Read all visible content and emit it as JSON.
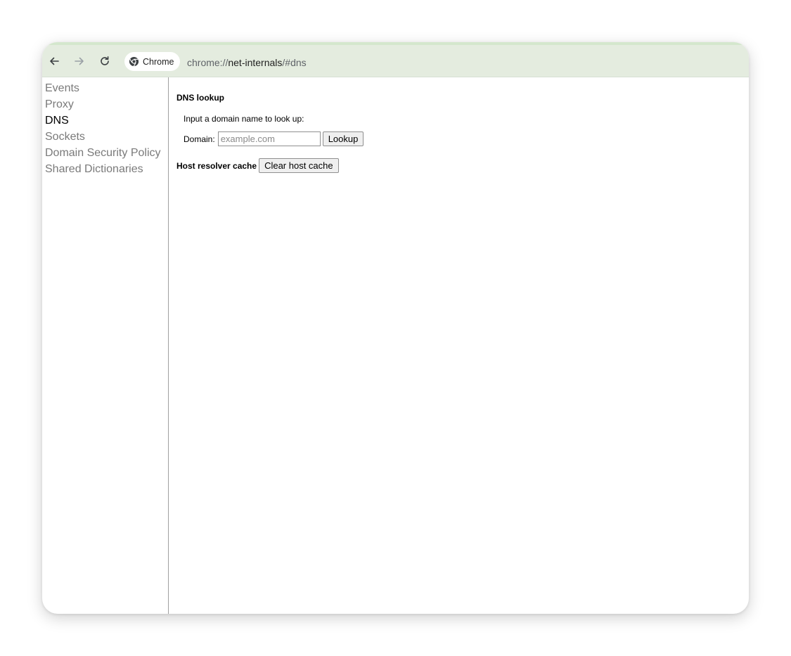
{
  "browser": {
    "chip_label": "Chrome",
    "url_scheme": "chrome://",
    "url_host": "net-internals",
    "url_path": "/#dns",
    "icons": {
      "back": "arrow-left-icon",
      "forward": "arrow-right-icon",
      "reload": "reload-icon",
      "chip": "chrome-logo-icon"
    },
    "colors": {
      "toolbar_bg": "#e4ecdf",
      "toolbar_top_strip": "#d4e7cd"
    }
  },
  "sidebar": {
    "items": [
      {
        "label": "Events"
      },
      {
        "label": "Proxy"
      },
      {
        "label": "DNS"
      },
      {
        "label": "Sockets"
      },
      {
        "label": "Domain Security Policy"
      },
      {
        "label": "Shared Dictionaries"
      }
    ],
    "active": "DNS"
  },
  "dns": {
    "lookup_title": "DNS lookup",
    "prompt": "Input a domain name to look up:",
    "domain_label": "Domain:",
    "domain_placeholder": "example.com",
    "domain_value": "",
    "lookup_button": "Lookup",
    "cache_title": "Host resolver cache",
    "clear_button": "Clear host cache"
  }
}
